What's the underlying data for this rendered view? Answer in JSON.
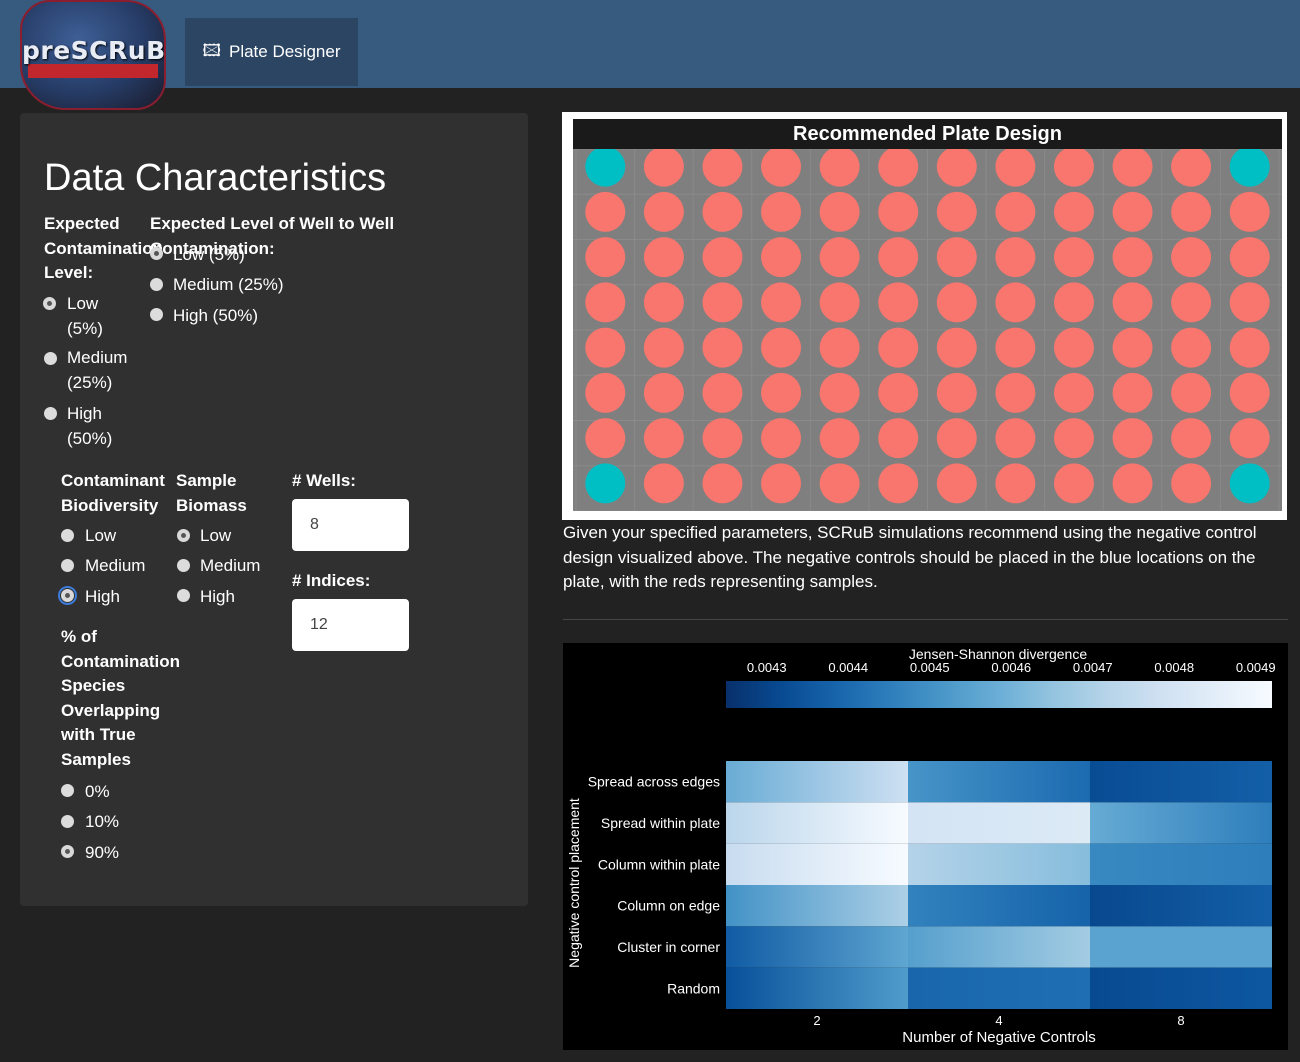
{
  "app": {
    "logo_text": "preSCRuB",
    "nav_tab_icon": "image-frame-icon",
    "nav_tab_label": "Plate Designer"
  },
  "panel": {
    "title": "Data Characteristics",
    "expected_contamination": {
      "label": "Expected Contamination Level:",
      "options": [
        "Low (5%)",
        "Medium (25%)",
        "High (50%)"
      ],
      "selected": "Low (5%)"
    },
    "well_to_well": {
      "label": "Expected Level of Well to Well Contamination:",
      "options": [
        "Low (5%)",
        "Medium (25%)",
        "High (50%)"
      ],
      "selected": "Low (5%)"
    },
    "biodiversity": {
      "label": "Contaminant Biodiversity",
      "options": [
        "Low",
        "Medium",
        "High"
      ],
      "selected": "High"
    },
    "biomass": {
      "label": "Sample Biomass",
      "options": [
        "Low",
        "Medium",
        "High"
      ],
      "selected": "Low"
    },
    "wells": {
      "label": "# Wells:",
      "value": "8"
    },
    "indices": {
      "label": "# Indices:",
      "value": "12"
    },
    "overlap": {
      "label": "% of Contamination Species Overlapping with True Samples",
      "options": [
        "0%",
        "10%",
        "90%"
      ],
      "selected": "90%"
    }
  },
  "plate": {
    "title": "Recommended Plate Design",
    "rows": 8,
    "cols": 12,
    "control_wells": [
      [
        0,
        0
      ],
      [
        0,
        11
      ],
      [
        7,
        0
      ],
      [
        7,
        11
      ]
    ],
    "colors": {
      "sample": "#f8766d",
      "control": "#00bfc4",
      "background": "#7f7f7f"
    }
  },
  "description": "Given your specified parameters, SCRuB simulations recommend using the negative control design visualized above. The negative controls should be placed in the blue locations on the plate, with the reds representing samples.",
  "chart_data": {
    "type": "heatmap",
    "title": "",
    "colorbar_title": "Jensen-Shannon divergence",
    "colorbar_ticks": [
      0.0043,
      0.0044,
      0.0045,
      0.0046,
      0.0047,
      0.0048,
      0.0049
    ],
    "colorbar_range": [
      0.00425,
      0.00492
    ],
    "xlabel": "Number of Negative Controls",
    "ylabel": "Negative control placement",
    "x": [
      "2",
      "4",
      "8"
    ],
    "y": [
      "Spread across edges",
      "Spread within plate",
      "Column within plate",
      "Column on edge",
      "Cluster in corner",
      "Random"
    ],
    "values": [
      [
        0.0047,
        0.00432,
        0.00432
      ],
      [
        0.00485,
        0.00475,
        0.0044
      ],
      [
        0.00488,
        0.00455,
        0.0044
      ],
      [
        0.00462,
        0.0043,
        0.00432
      ],
      [
        0.00448,
        0.0046,
        0.0045
      ],
      [
        0.00445,
        0.00433,
        0.0043
      ]
    ],
    "colorscale": "Blues"
  }
}
